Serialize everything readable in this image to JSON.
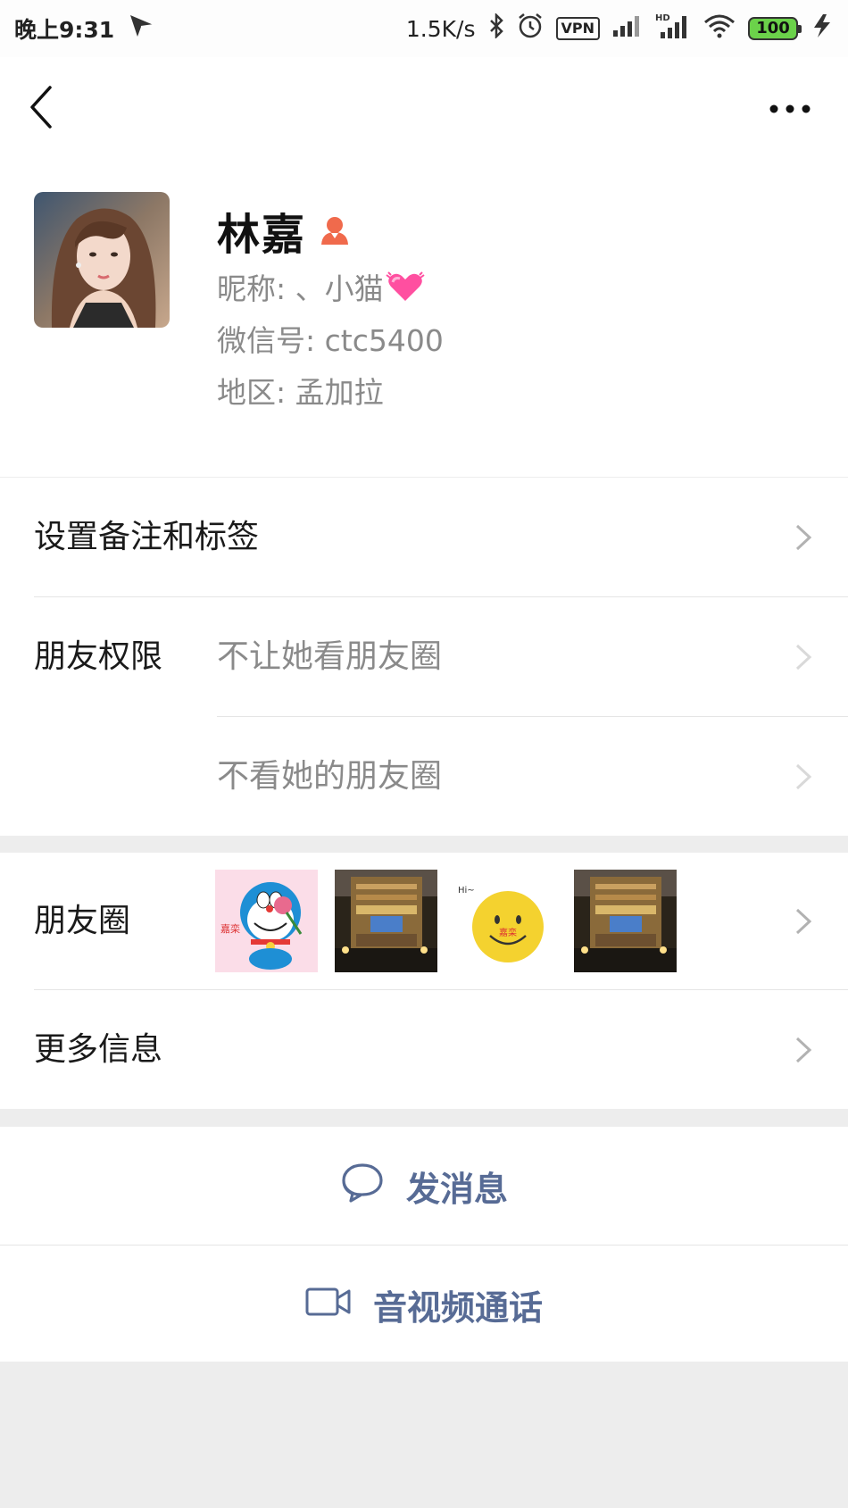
{
  "status_bar": {
    "time": "晚上9:31",
    "net_speed": "1.5K/s",
    "vpn": "VPN",
    "battery": "100",
    "icons": [
      "send-icon",
      "bluetooth-icon",
      "alarm-icon",
      "vpn-icon",
      "signal-icon",
      "hd-signal-icon",
      "wifi-icon",
      "battery-icon",
      "charging-icon"
    ]
  },
  "nav": {
    "icons": [
      "back-icon",
      "more-icon"
    ]
  },
  "profile": {
    "name": "林嘉",
    "gender_icon": "female-icon",
    "nickname_line": "昵称: 、小猫",
    "nickname_emoji": "heart-emoji",
    "wechat_id_line": "微信号: ctc5400",
    "region_line": "地区: 孟加拉"
  },
  "rows": {
    "remark_label": "设置备注和标签",
    "permission_label": "朋友权限",
    "permission_option_1": "不让她看朋友圈",
    "permission_option_2": "不看她的朋友圈",
    "moments_label": "朋友圈",
    "more_info_label": "更多信息"
  },
  "actions": {
    "message": "发消息",
    "video_call": "音视频通话"
  },
  "colors": {
    "link": "#576b95",
    "background": "#ededed",
    "card": "#ffffff",
    "female_icon": "#f06a4c"
  }
}
